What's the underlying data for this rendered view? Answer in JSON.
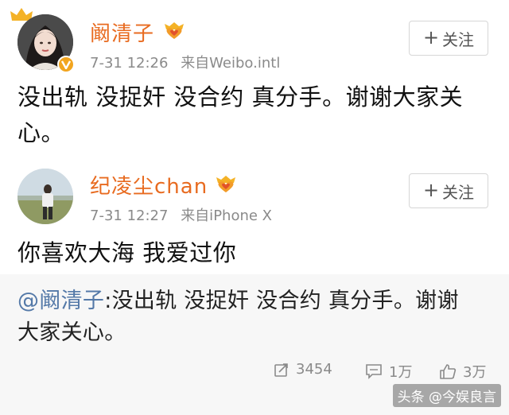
{
  "posts": [
    {
      "username": "阚清子",
      "time": "7-31 12:26",
      "source": "来自Weibo.intl",
      "follow_label": "关注",
      "content": "没出轨 没捉奸 没合约 真分手。谢谢大家关心。",
      "avatar_icon": "woman-portrait",
      "verified_icon": "verified-v-badge",
      "vip_icon": "vip-heart-crown"
    },
    {
      "username": "纪凌尘chan",
      "time": "7-31 12:27",
      "source": "来自iPhone X",
      "follow_label": "关注",
      "content": "你喜欢大海 我爱过你",
      "avatar_icon": "man-standing-field",
      "vip_icon": "vip-heart-crown",
      "repost": {
        "mention": "@阚清子",
        "text": ":没出轨 没捉奸 没合约 真分手。谢谢大家关心。"
      },
      "actions": {
        "share_count": "3454",
        "comment_count": "1万",
        "like_count": "3万"
      }
    }
  ],
  "watermark": "头条 @今娱良言",
  "colors": {
    "username": "#e86b20",
    "mention": "#5479a8",
    "meta": "#8a8a8a",
    "repost_bg": "#f7f7f7"
  }
}
